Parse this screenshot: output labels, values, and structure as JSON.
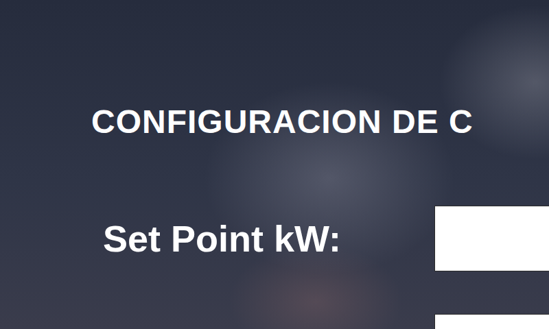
{
  "page": {
    "title": "CONFIGURACION DE C"
  },
  "fields": [
    {
      "label": "Set Point kW:",
      "value": ""
    },
    {
      "label": "",
      "value": ""
    }
  ]
}
